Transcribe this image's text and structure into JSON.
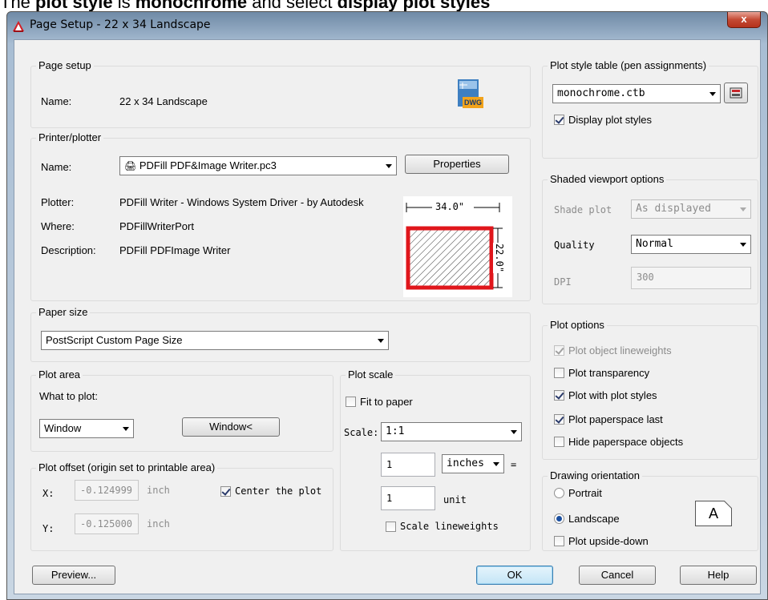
{
  "instruction": {
    "prefix": "The ",
    "bold1": "plot style",
    "mid": " is ",
    "bold2": "monochrome",
    "mid2": " and select ",
    "bold3": "display plot styles"
  },
  "window": {
    "title": "Page Setup - 22 x 34 Landscape",
    "close": "x"
  },
  "page_setup": {
    "group": "Page setup",
    "name_label": "Name:",
    "name_value": "22 x 34 Landscape",
    "dwg_badge": "DWG"
  },
  "printer": {
    "group": "Printer/plotter",
    "name_label": "Name:",
    "name_value": "PDFill PDF&Image Writer.pc3",
    "properties_button": "Properties",
    "plotter_label": "Plotter:",
    "plotter_value": "PDFill Writer - Windows System Driver - by Autodesk",
    "where_label": "Where:",
    "where_value": "PDFillWriterPort",
    "description_label": "Description:",
    "description_value": "PDFill PDFImage Writer",
    "preview_width": "34.0\"",
    "preview_height": "22.0\""
  },
  "paper_size": {
    "group": "Paper size",
    "value": "PostScript Custom Page Size"
  },
  "plot_area": {
    "group": "Plot area",
    "what_label": "What to plot:",
    "what_value": "Window",
    "window_button": "Window<"
  },
  "plot_offset": {
    "group": "Plot offset (origin set to printable area)",
    "x_label": "X:",
    "x_value": "-0.124999",
    "x_unit": "inch",
    "y_label": "Y:",
    "y_value": "-0.125000",
    "y_unit": "inch",
    "center_label": "Center the plot",
    "center_checked": true
  },
  "plot_scale": {
    "group": "Plot scale",
    "fit_label": "Fit to paper",
    "fit_checked": false,
    "scale_label": "Scale:",
    "scale_value": "1:1",
    "inches_value": "1",
    "inches_unit": "inches",
    "equals": "=",
    "unit_value": "1",
    "unit_label": "unit",
    "lineweights_label": "Scale lineweights",
    "lineweights_checked": false
  },
  "plot_style_table": {
    "group": "Plot style table (pen assignments)",
    "value": "monochrome.ctb",
    "display_label": "Display plot styles",
    "display_checked": true
  },
  "shaded": {
    "group": "Shaded viewport options",
    "shade_label": "Shade plot",
    "shade_value": "As displayed",
    "quality_label": "Quality",
    "quality_value": "Normal",
    "dpi_label": "DPI",
    "dpi_value": "300"
  },
  "plot_options": {
    "group": "Plot options",
    "items": [
      {
        "label": "Plot object lineweights",
        "checked": true,
        "disabled": true
      },
      {
        "label": "Plot transparency",
        "checked": false,
        "disabled": false
      },
      {
        "label": "Plot with plot styles",
        "checked": true,
        "disabled": false
      },
      {
        "label": "Plot paperspace last",
        "checked": true,
        "disabled": false
      },
      {
        "label": "Hide paperspace objects",
        "checked": false,
        "disabled": false
      }
    ]
  },
  "orientation": {
    "group": "Drawing orientation",
    "portrait": "Portrait",
    "landscape": "Landscape",
    "selected": "Landscape",
    "upside_down": "Plot upside-down",
    "upside_checked": false,
    "icon_letter": "A"
  },
  "buttons": {
    "preview": "Preview...",
    "ok": "OK",
    "cancel": "Cancel",
    "help": "Help"
  },
  "colors": {
    "accent_red": "#e0161b",
    "title_bar": "#a8bdd3"
  }
}
